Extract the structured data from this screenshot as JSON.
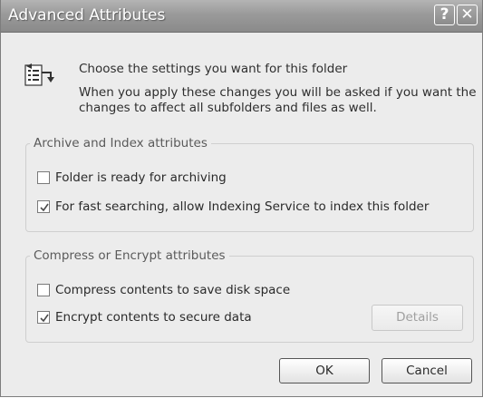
{
  "window": {
    "title": "Advanced Attributes",
    "help_glyph": "?",
    "close_glyph": "✕"
  },
  "header": {
    "icon": "folder-properties-icon",
    "line1": "Choose the settings you want for this folder",
    "line2": "When you apply these changes you will be asked if you want the",
    "line3": "changes to affect all subfolders and files as well."
  },
  "archive_group": {
    "label": "Archive and Index attributes",
    "options": [
      {
        "label": "Folder is ready for archiving",
        "checked": false
      },
      {
        "label": "For fast searching, allow Indexing Service to index this folder",
        "checked": true
      }
    ]
  },
  "compress_group": {
    "label": "Compress or Encrypt attributes",
    "options": [
      {
        "label": "Compress contents to save disk space",
        "checked": false
      },
      {
        "label": "Encrypt contents to secure data",
        "checked": true
      }
    ],
    "details_label": "Details",
    "details_enabled": false
  },
  "buttons": {
    "ok_label": "OK",
    "cancel_label": "Cancel"
  }
}
